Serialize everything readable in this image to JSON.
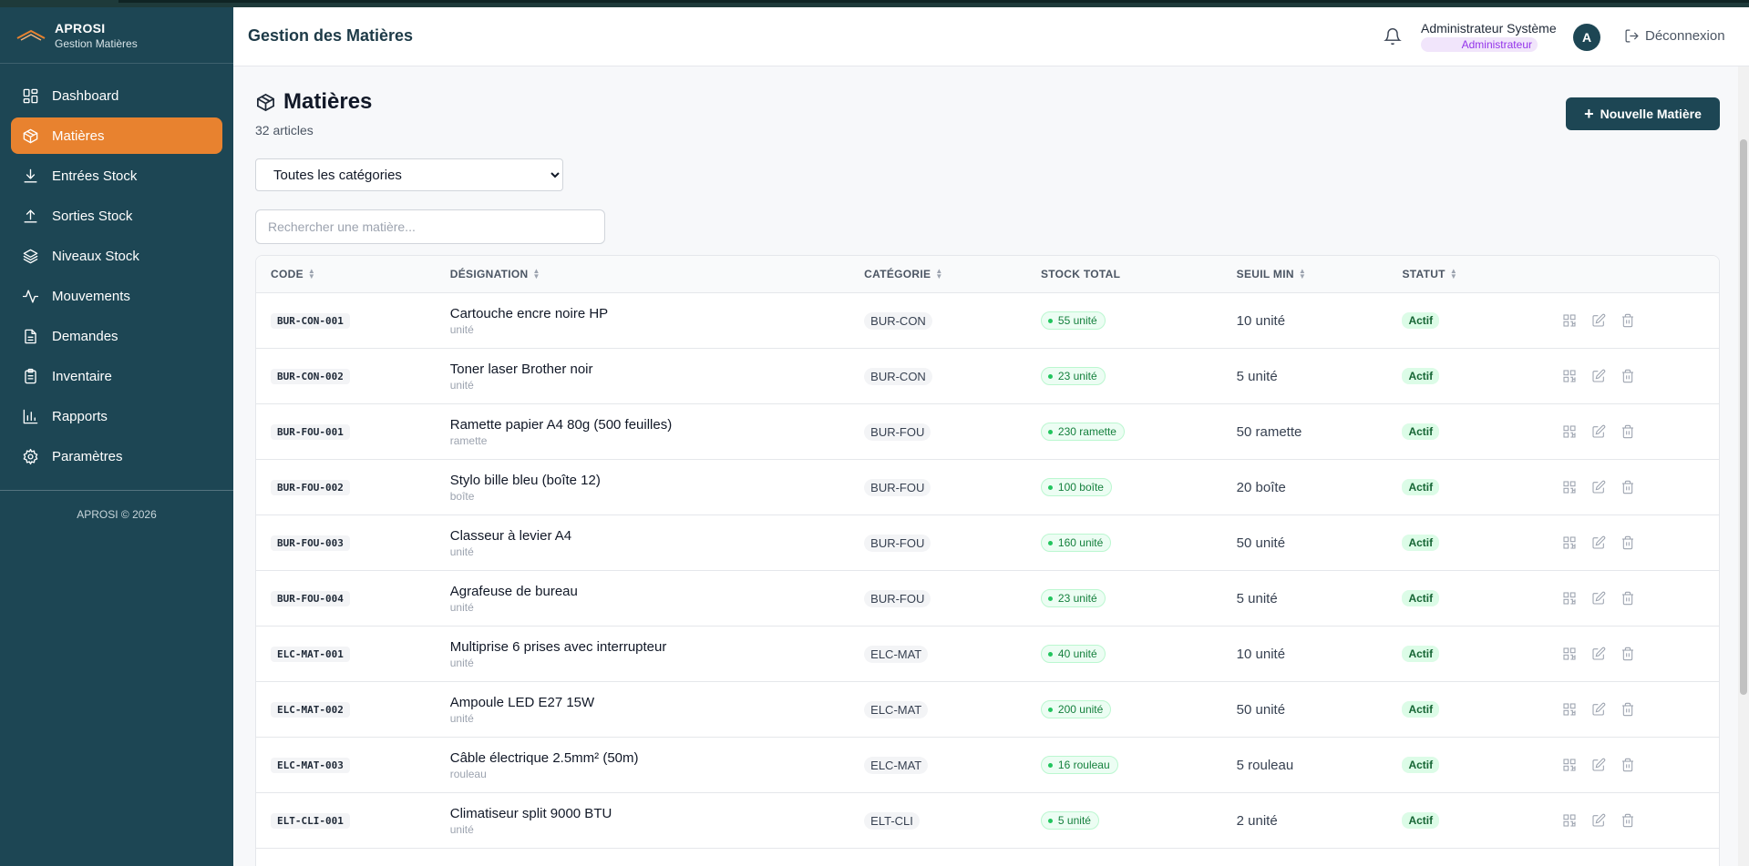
{
  "brand": {
    "title": "APROSI",
    "subtitle": "Gestion Matières"
  },
  "sidebar": {
    "items": [
      {
        "label": "Dashboard",
        "icon": "dashboard-icon",
        "active": false
      },
      {
        "label": "Matières",
        "icon": "package-icon",
        "active": true
      },
      {
        "label": "Entrées Stock",
        "icon": "download-icon",
        "active": false
      },
      {
        "label": "Sorties Stock",
        "icon": "upload-icon",
        "active": false
      },
      {
        "label": "Niveaux Stock",
        "icon": "layers-icon",
        "active": false
      },
      {
        "label": "Mouvements",
        "icon": "activity-icon",
        "active": false
      },
      {
        "label": "Demandes",
        "icon": "file-icon",
        "active": false
      },
      {
        "label": "Inventaire",
        "icon": "clipboard-icon",
        "active": false
      },
      {
        "label": "Rapports",
        "icon": "bar-chart-icon",
        "active": false
      },
      {
        "label": "Paramètres",
        "icon": "gear-icon",
        "active": false
      }
    ],
    "copyright": "APROSI © 2026"
  },
  "header": {
    "title": "Gestion des Matières",
    "user_name": "Administrateur Système",
    "user_role": "Administrateur",
    "avatar_initial": "A",
    "logout_label": "Déconnexion"
  },
  "page": {
    "title": "Matières",
    "count": "32 articles",
    "new_button": "Nouvelle Matière",
    "category_filter": {
      "selected": "Toutes les catégories",
      "options": [
        "Toutes les catégories"
      ]
    },
    "search_placeholder": "Rechercher une matière..."
  },
  "table": {
    "columns": [
      "CODE",
      "DÉSIGNATION",
      "CATÉGORIE",
      "STOCK TOTAL",
      "SEUIL MIN",
      "STATUT"
    ],
    "rows": [
      {
        "code": "BUR-CON-001",
        "name": "Cartouche encre noire HP",
        "unit": "unité",
        "category": "BUR-CON",
        "stock": "55 unité",
        "seuil": "10 unité",
        "status": "Actif"
      },
      {
        "code": "BUR-CON-002",
        "name": "Toner laser Brother noir",
        "unit": "unité",
        "category": "BUR-CON",
        "stock": "23 unité",
        "seuil": "5 unité",
        "status": "Actif"
      },
      {
        "code": "BUR-FOU-001",
        "name": "Ramette papier A4 80g (500 feuilles)",
        "unit": "ramette",
        "category": "BUR-FOU",
        "stock": "230 ramette",
        "seuil": "50 ramette",
        "status": "Actif"
      },
      {
        "code": "BUR-FOU-002",
        "name": "Stylo bille bleu (boîte 12)",
        "unit": "boîte",
        "category": "BUR-FOU",
        "stock": "100 boîte",
        "seuil": "20 boîte",
        "status": "Actif"
      },
      {
        "code": "BUR-FOU-003",
        "name": "Classeur à levier A4",
        "unit": "unité",
        "category": "BUR-FOU",
        "stock": "160 unité",
        "seuil": "50 unité",
        "status": "Actif"
      },
      {
        "code": "BUR-FOU-004",
        "name": "Agrafeuse de bureau",
        "unit": "unité",
        "category": "BUR-FOU",
        "stock": "23 unité",
        "seuil": "5 unité",
        "status": "Actif"
      },
      {
        "code": "ELC-MAT-001",
        "name": "Multiprise 6 prises avec interrupteur",
        "unit": "unité",
        "category": "ELC-MAT",
        "stock": "40 unité",
        "seuil": "10 unité",
        "status": "Actif"
      },
      {
        "code": "ELC-MAT-002",
        "name": "Ampoule LED E27 15W",
        "unit": "unité",
        "category": "ELC-MAT",
        "stock": "200 unité",
        "seuil": "50 unité",
        "status": "Actif"
      },
      {
        "code": "ELC-MAT-003",
        "name": "Câble électrique 2.5mm² (50m)",
        "unit": "rouleau",
        "category": "ELC-MAT",
        "stock": "16 rouleau",
        "seuil": "5 rouleau",
        "status": "Actif"
      },
      {
        "code": "ELT-CLI-001",
        "name": "Climatiseur split 9000 BTU",
        "unit": "unité",
        "category": "ELT-CLI",
        "stock": "5 unité",
        "seuil": "2 unité",
        "status": "Actif"
      }
    ]
  },
  "colors": {
    "sidebar": "#1d4654",
    "active": "#e8822f",
    "primary": "#1d4654",
    "success": "#15803d"
  }
}
